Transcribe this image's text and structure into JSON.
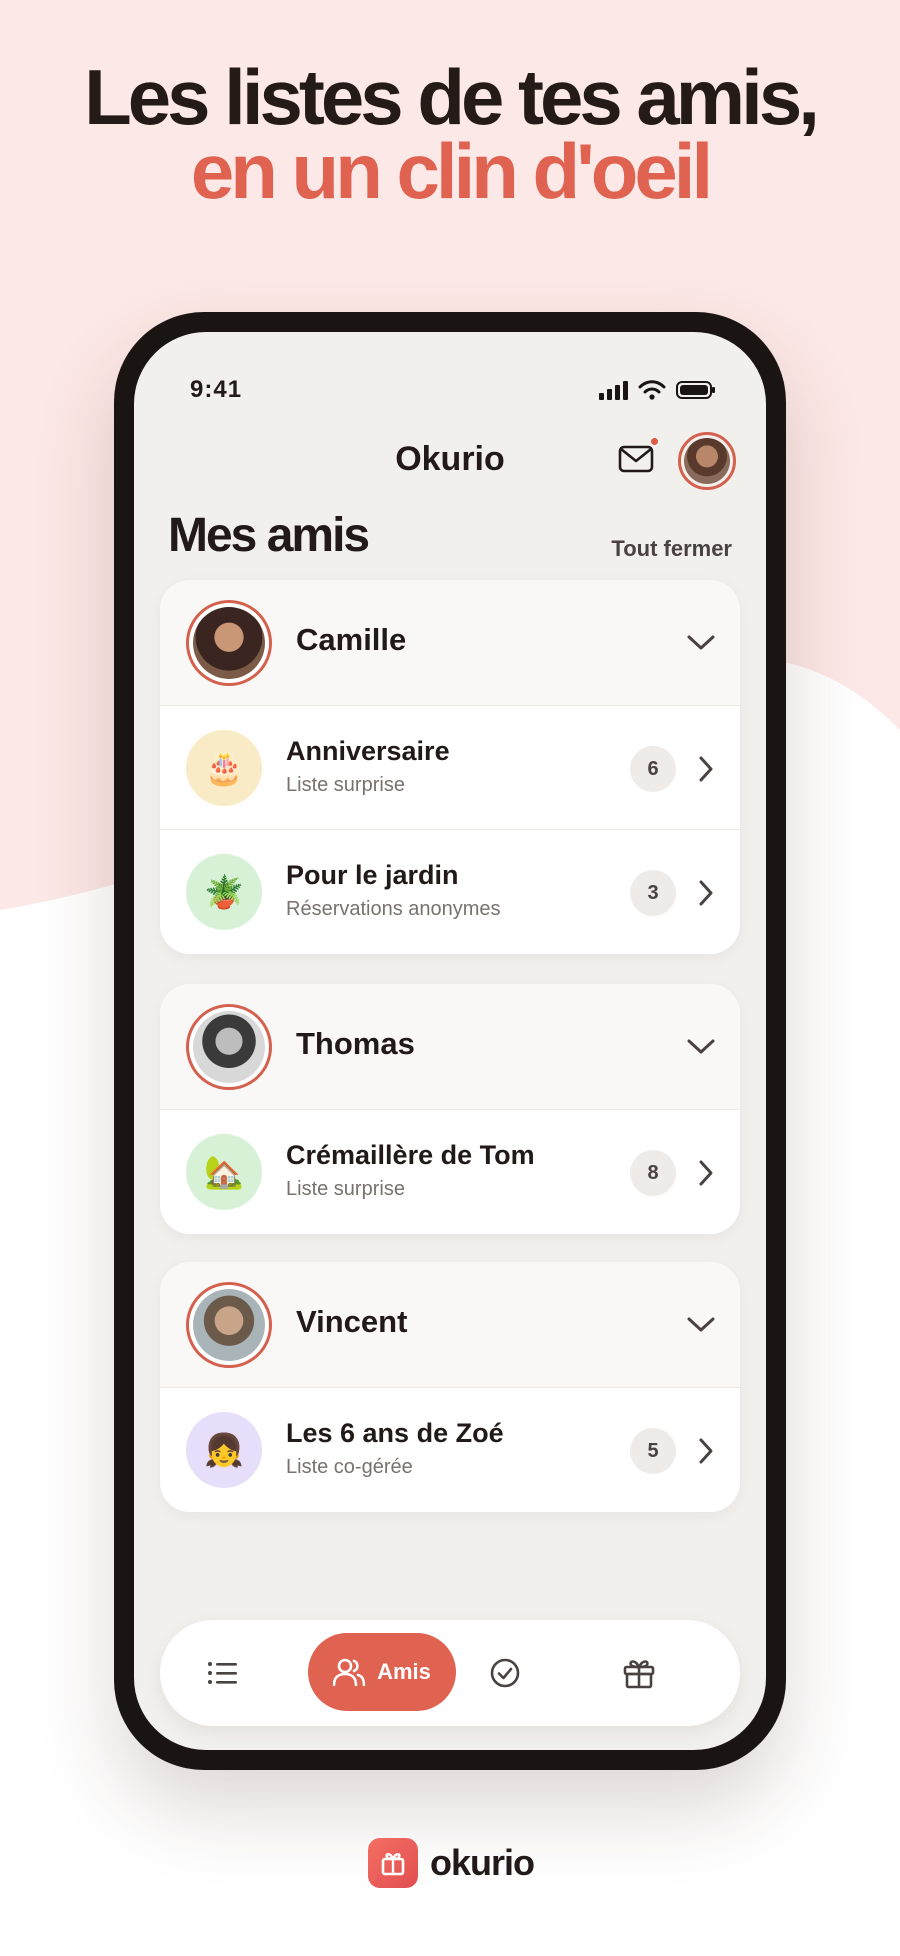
{
  "headline": {
    "line1": "Les listes de tes amis,",
    "line2": "en un clin d'oeil"
  },
  "status_bar": {
    "time": "9:41"
  },
  "header": {
    "app_title": "Okurio"
  },
  "section": {
    "title": "Mes amis",
    "close_all_label": "Tout fermer"
  },
  "groups": [
    {
      "friend": "Camille",
      "lists": [
        {
          "title": "Anniversaire",
          "subtitle": "Liste surprise",
          "count": "6",
          "icon": "🎂"
        },
        {
          "title": "Pour le jardin",
          "subtitle": "Réservations anonymes",
          "count": "3",
          "icon": "🪴"
        }
      ]
    },
    {
      "friend": "Thomas",
      "lists": [
        {
          "title": "Crémaillère de Tom",
          "subtitle": "Liste surprise",
          "count": "8",
          "icon": "🏡"
        }
      ]
    },
    {
      "friend": "Vincent",
      "lists": [
        {
          "title": "Les 6 ans de Zoé",
          "subtitle": "Liste co-gérée",
          "count": "5",
          "icon": "👧"
        }
      ]
    }
  ],
  "tabbar": {
    "active_label": "Amis"
  },
  "brand": {
    "name": "okurio"
  },
  "colors": {
    "accent": "#df6350",
    "background_pink": "#fce8e6",
    "screen": "#f2f0ed"
  }
}
